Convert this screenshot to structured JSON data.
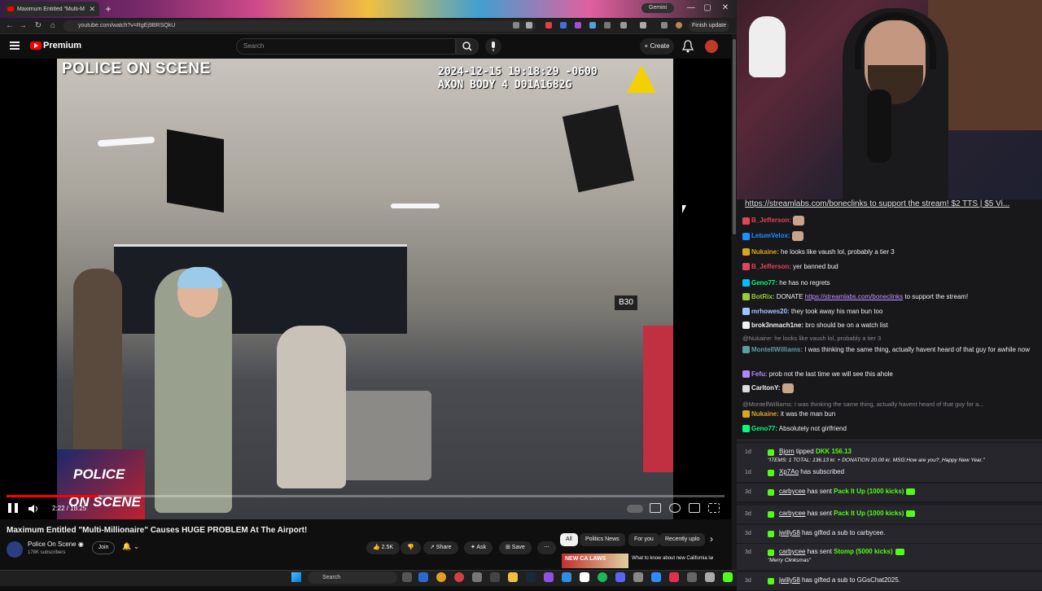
{
  "browser": {
    "tab_title": "Maximum Entitled \"Multi-M",
    "tab_new": "+",
    "gemini": "Gemini",
    "url": "youtube.com/watch?v=RgEj9BRSQkU",
    "finish_update": "Finish update",
    "win_min": "—",
    "win_max": "▢",
    "win_close": "✕"
  },
  "youtube": {
    "premium_label": "Premium",
    "search_placeholder": "Search",
    "create_label": "+ Create"
  },
  "video": {
    "overlay_title": "POLICE ON SCENE",
    "timestamp_line1": "2024-12-15 19:18:29 -0600",
    "timestamp_line2": "AXON BODY 4 D01A1682G",
    "gate_sign": "B30",
    "brand_line1": "POLICE",
    "brand_line2": "ON SCENE",
    "time_display": "2:22 / 18:25",
    "progress": 0.128
  },
  "below_video": {
    "title": "Maximum Entitled \"Multi-Millionaire\" Causes HUGE PROBLEM At The Airport!",
    "channel_name": "Police On Scene ◉",
    "channel_subs": "178K subscribers",
    "join": "Join",
    "bell": "🔔 ⌄",
    "like_count": "👍 2.5K",
    "dislike": "👎",
    "share": "↗ Share",
    "ask": "✦ Ask",
    "save": "⊞ Save",
    "more": "⋯",
    "chips": [
      "All",
      "Politics News",
      "For you",
      "Recently uplo"
    ],
    "chip_next": "›",
    "rec_thumb_text": "NEW CA LAWS",
    "rec_title": "What to know about new California laws taking effect"
  },
  "taskbar": {
    "search": "Search"
  },
  "chat": {
    "pinned": "https://streamlabs.com/boneclinks to support the stream! $2 TTS | $5 Vi...",
    "messages": [
      {
        "user": "B_Jefferson:",
        "user_color": "#e2445c",
        "text": ""
      },
      {
        "user": "LetumVelox:",
        "user_color": "#1e90ff",
        "text": ""
      },
      {
        "user": "Nukaine:",
        "user_color": "#daa520",
        "text": "he looks like vaush lol, probably a tier 3"
      },
      {
        "user": "B_Jefferson:",
        "user_color": "#e2445c",
        "text": "yer banned bud"
      },
      {
        "user": "Geno77:",
        "user_color": "#00ff7f",
        "text": "he has no regrets"
      },
      {
        "user": "BotRix:",
        "user_color": "#9acd32",
        "text": "DONATE",
        "link": "https://streamlabs.com/boneclinks",
        "tail": "to support the stream!"
      },
      {
        "user": "mrhowes20:",
        "user_color": "#a0c4ff",
        "text": "they took away his man bun too"
      },
      {
        "user": "brok3nmach1ne:",
        "user_color": "#f0f0f0",
        "text": "bro should be on a watch list"
      },
      {
        "reply": "@Nukaine: he looks like vaush lol, probably a tier 3"
      },
      {
        "user": "MontellWilliams:",
        "user_color": "#5f9ea0",
        "text": "I was thinking the same thing, actually havent heard of that guy for awhile now"
      },
      {
        "user": "Fefu:",
        "user_color": "#b088ff",
        "text": "prob not the last time we will see this ahole"
      },
      {
        "user": "CarltonY:",
        "user_color": "#f0f0f0",
        "text": ""
      },
      {
        "reply": "@MontellWilliams: I was thinking the same thing, actually havent heard of that guy for a..."
      },
      {
        "user": "Nukaine:",
        "user_color": "#daa520",
        "text": "it was the man bun"
      },
      {
        "user": "Geno77:",
        "user_color": "#00ff7f",
        "text": "Absolutely not girlfriend"
      }
    ]
  },
  "events": [
    {
      "time": "1d",
      "user": "Bjorn",
      "text": " tipped ",
      "amount": "DKK 156.13",
      "sub": "\"ITEMS: 1 TOTAL: 136.13 kr. + DONATION 20.00 kr. MSG:How are you?_Happy New Year.\""
    },
    {
      "time": "1d",
      "user": "Xp7Ao",
      "text": " has subscribed"
    },
    {
      "time": "3d",
      "user": "carbycee",
      "text": " has sent ",
      "amount": "Pack It Up (1000 kicks)"
    },
    {
      "time": "3d",
      "user": "carbycee",
      "text": " has sent ",
      "amount": "Pack It Up (1000 kicks)"
    },
    {
      "time": "3d",
      "user": "jwilly58",
      "text": " has gifted a sub to carbycee."
    },
    {
      "time": "3d",
      "user": "carbycee",
      "text": " has sent ",
      "amount": "Stomp (5000 kicks)",
      "sub": "\"Merry Clinksmas\""
    },
    {
      "time": "3d",
      "user": "jwilly58",
      "text": " has gifted a sub to GGsChat2025."
    }
  ]
}
